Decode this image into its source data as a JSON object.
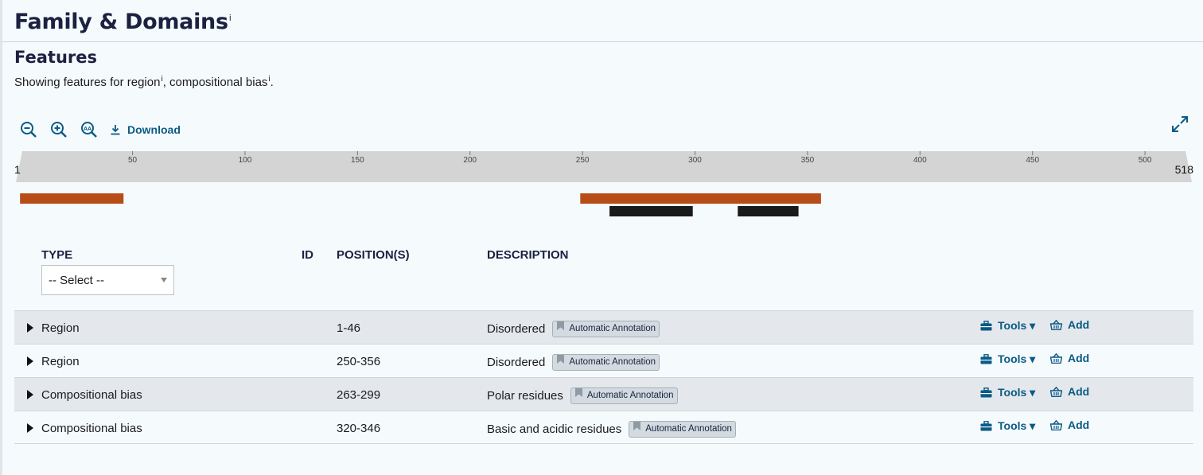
{
  "page": {
    "title": "Family & Domains",
    "title_sup": "i",
    "section": "Features",
    "subtitle_prefix": "Showing features for region",
    "subtitle_mid": ", compositional bias",
    "subtitle_end": ".",
    "sup": "i"
  },
  "toolbar": {
    "zoom_out_icon": "zoom-out-icon",
    "zoom_in_icon": "zoom-in-icon",
    "zoom_fit_icon": "zoom-fit-icon",
    "download_label": "Download",
    "fullscreen_icon": "expand-icon"
  },
  "viewer": {
    "start": 1,
    "end": 518,
    "ticks": [
      50,
      100,
      150,
      200,
      250,
      300,
      350,
      400,
      450,
      500
    ],
    "start_label": "1",
    "end_label": "518",
    "colors": {
      "region": "#b84c17",
      "compositional_bias": "#1a1a1a",
      "axis_bg": "#d4d4d4"
    },
    "features": [
      {
        "type": "region",
        "start": 1,
        "end": 46
      },
      {
        "type": "region",
        "start": 250,
        "end": 356
      },
      {
        "type": "compositional_bias",
        "start": 263,
        "end": 299
      },
      {
        "type": "compositional_bias",
        "start": 320,
        "end": 346
      }
    ]
  },
  "table": {
    "headers": {
      "type": "TYPE",
      "id": "ID",
      "positions": "POSITION(S)",
      "description": "DESCRIPTION"
    },
    "filter": {
      "selected": "-- Select --"
    },
    "rows": [
      {
        "type": "Region",
        "position": "1-46",
        "description": "Disordered",
        "badge": "Automatic Annotation",
        "tools": "Tools ▾",
        "add": "Add"
      },
      {
        "type": "Region",
        "position": "250-356",
        "description": "Disordered",
        "badge": "Automatic Annotation",
        "tools": "Tools ▾",
        "add": "Add"
      },
      {
        "type": "Compositional bias",
        "position": "263-299",
        "description": "Polar residues",
        "badge": "Automatic Annotation",
        "tools": "Tools ▾",
        "add": "Add"
      },
      {
        "type": "Compositional bias",
        "position": "320-346",
        "description": "Basic and acidic residues",
        "badge": "Automatic Annotation",
        "tools": "Tools ▾",
        "add": "Add"
      }
    ]
  }
}
